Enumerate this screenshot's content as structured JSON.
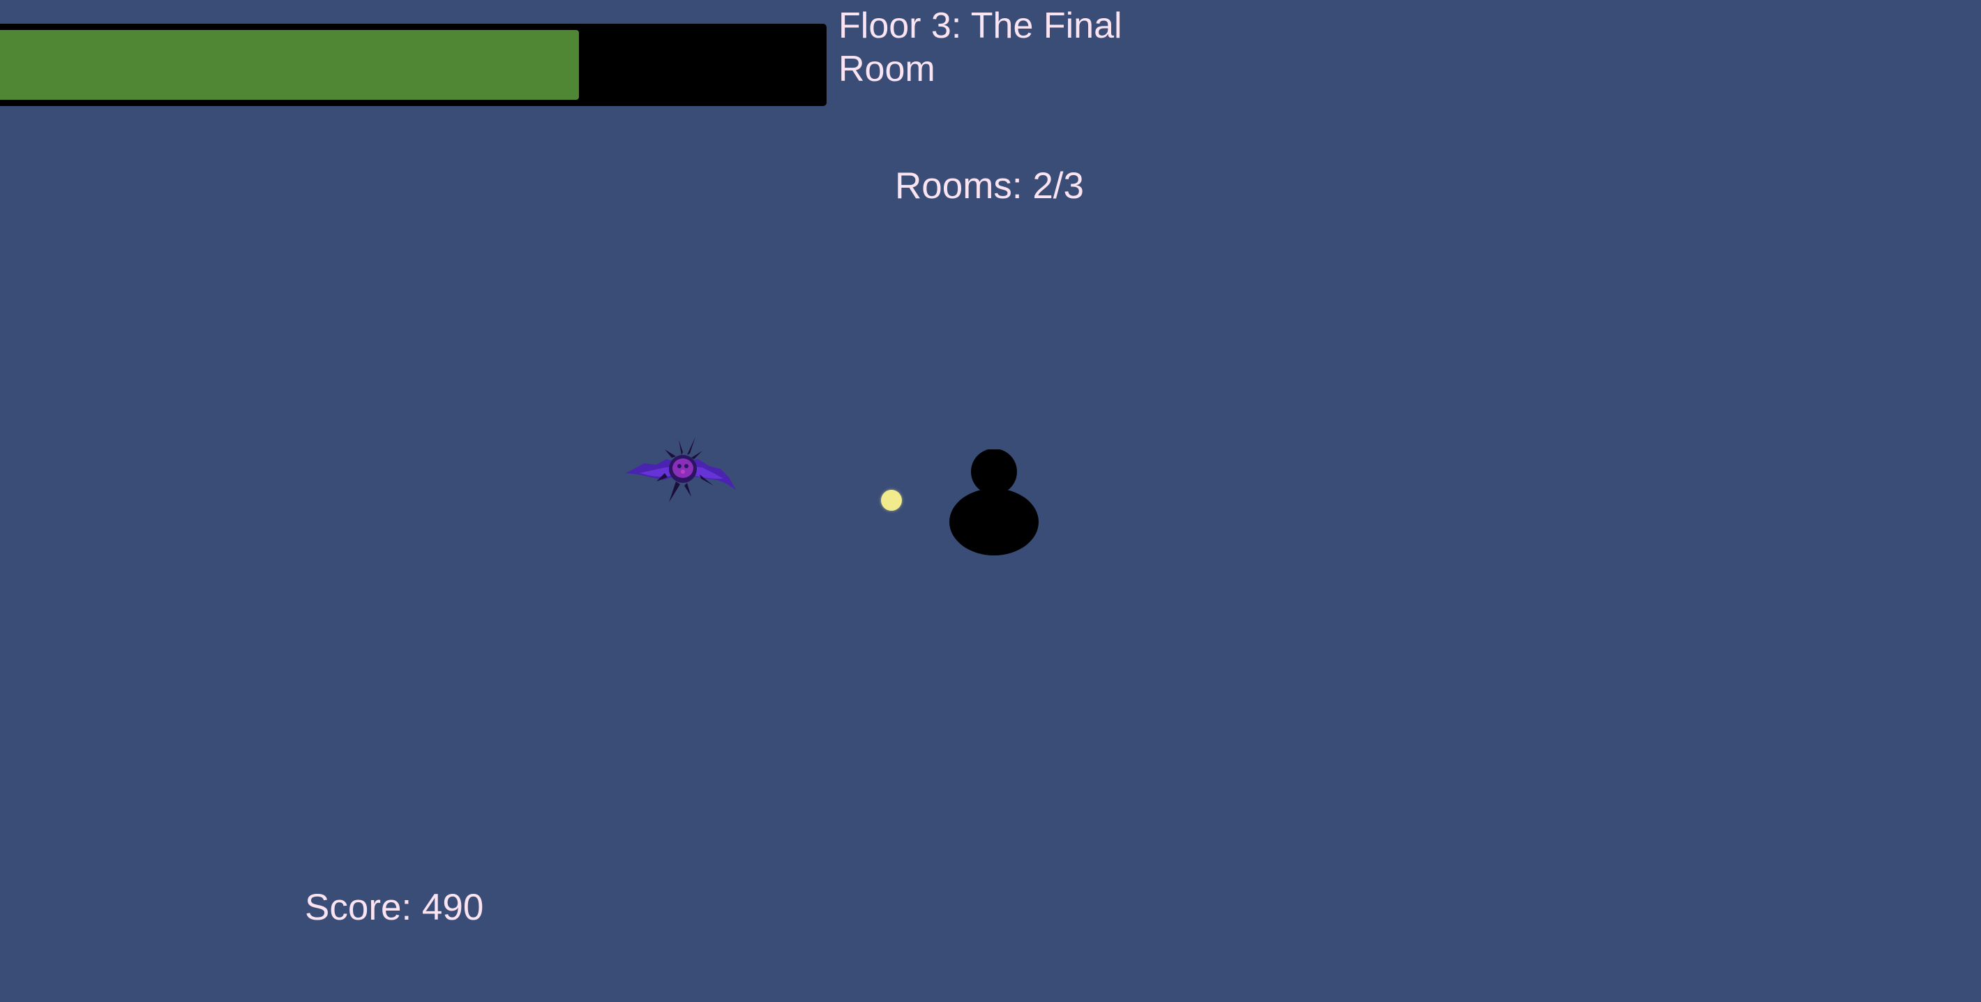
{
  "hud": {
    "health": {
      "fraction": 0.7,
      "bar_color": "#4f8735",
      "track_color": "#000000"
    },
    "floor_title": "Floor 3: The Final Room",
    "rooms_counter": "Rooms: 2/3",
    "score": "Score: 490",
    "text_color": "#fbe4f2"
  },
  "scene": {
    "background_color": "#3a4d77",
    "enemy": {
      "icon": "bat-icon",
      "color": "#5b2cc0"
    },
    "projectile": {
      "icon": "energy-orb",
      "color": "#f1eb8e"
    },
    "player": {
      "icon": "player-silhouette",
      "color": "#000000"
    }
  }
}
